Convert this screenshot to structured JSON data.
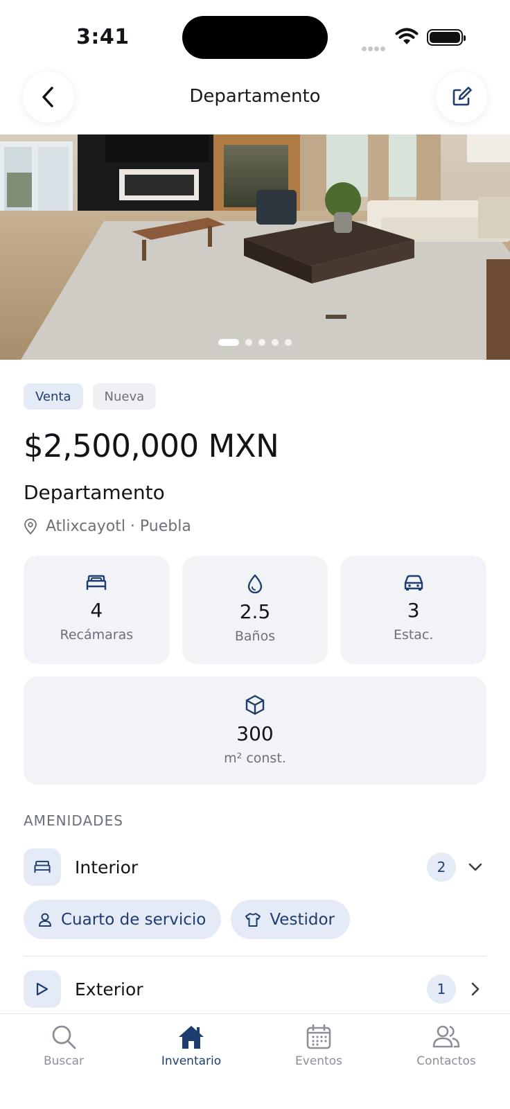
{
  "status": {
    "time": "3:41"
  },
  "header": {
    "title": "Departamento"
  },
  "gallery": {
    "pages": 5,
    "active_page": 1
  },
  "listing": {
    "tags": [
      "Venta",
      "Nueva"
    ],
    "price": "$2,500,000 MXN",
    "type": "Departamento",
    "location": "Atlixcayotl · Puebla"
  },
  "stats": [
    {
      "icon": "bed-icon",
      "value": "4",
      "label": "Recámaras"
    },
    {
      "icon": "water-drop-icon",
      "value": "2.5",
      "label": "Baños"
    },
    {
      "icon": "car-icon",
      "value": "3",
      "label": "Estac."
    },
    {
      "icon": "cube-icon",
      "value": "300",
      "label": "m² const."
    }
  ],
  "amenities": {
    "section_title": "AMENIDADES",
    "groups": [
      {
        "name": "Interior",
        "count": "2",
        "icon": "bed-icon",
        "expanded": true,
        "items": [
          {
            "label": "Cuarto de servicio",
            "icon": "person-icon"
          },
          {
            "label": "Vestidor",
            "icon": "shirt-icon"
          }
        ]
      },
      {
        "name": "Exterior",
        "count": "1",
        "icon": "tree-icon",
        "expanded": false
      }
    ]
  },
  "tab_bar": {
    "tabs": [
      {
        "label": "Buscar",
        "icon": "search-icon"
      },
      {
        "label": "Inventario",
        "icon": "home-icon",
        "active": true
      },
      {
        "label": "Eventos",
        "icon": "calendar-icon"
      },
      {
        "label": "Contactos",
        "icon": "contacts-icon"
      }
    ]
  },
  "colors": {
    "accent": "#1e3d6f",
    "accent_bg": "#e4eaf6",
    "card_bg": "#f1f3f6",
    "muted_text": "#6b7079"
  }
}
